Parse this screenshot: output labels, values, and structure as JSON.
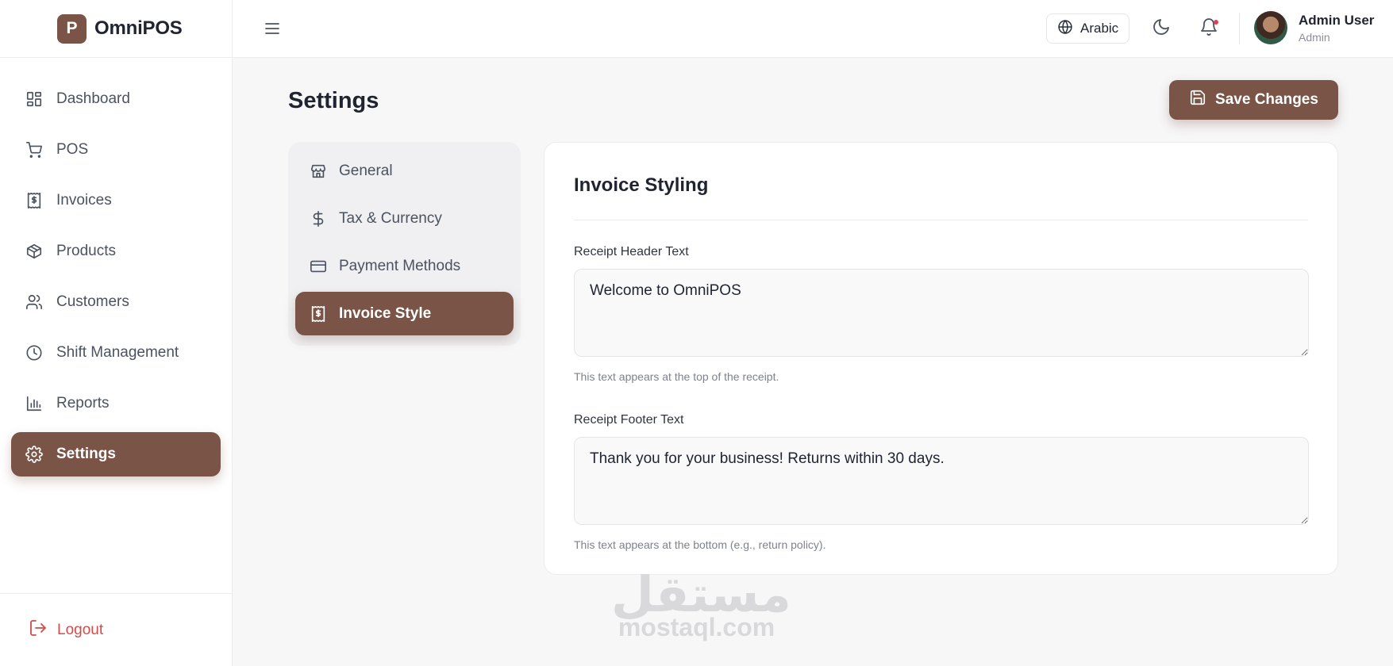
{
  "brand": {
    "logo_letter": "P",
    "name": "OmniPOS"
  },
  "sidebar": {
    "items": [
      {
        "label": "Dashboard",
        "icon": "dashboard-icon",
        "active": false
      },
      {
        "label": "POS",
        "icon": "cart-icon",
        "active": false
      },
      {
        "label": "Invoices",
        "icon": "receipt-icon",
        "active": false
      },
      {
        "label": "Products",
        "icon": "box-icon",
        "active": false
      },
      {
        "label": "Customers",
        "icon": "users-icon",
        "active": false
      },
      {
        "label": "Shift Management",
        "icon": "clock-icon",
        "active": false
      },
      {
        "label": "Reports",
        "icon": "bar-chart-icon",
        "active": false
      },
      {
        "label": "Settings",
        "icon": "gear-icon",
        "active": true
      }
    ],
    "logout_label": "Logout"
  },
  "topbar": {
    "language_label": "Arabic",
    "user": {
      "name": "Admin User",
      "role": "Admin"
    }
  },
  "page": {
    "title": "Settings",
    "save_label": "Save Changes"
  },
  "settings_nav": {
    "items": [
      {
        "label": "General",
        "icon": "store-icon",
        "active": false
      },
      {
        "label": "Tax & Currency",
        "icon": "dollar-icon",
        "active": false
      },
      {
        "label": "Payment Methods",
        "icon": "credit-card-icon",
        "active": false
      },
      {
        "label": "Invoice Style",
        "icon": "receipt-icon",
        "active": true
      }
    ]
  },
  "invoice_styling": {
    "title": "Invoice Styling",
    "header_label": "Receipt Header Text",
    "header_value": "Welcome to OmniPOS",
    "header_hint": "This text appears at the top of the receipt.",
    "footer_label": "Receipt Footer Text",
    "footer_value": "Thank you for your business! Returns within 30 days.",
    "footer_hint": "This text appears at the bottom (e.g., return policy)."
  },
  "watermark": {
    "arabic": "مستقل",
    "latin": "mostaql.com"
  },
  "colors": {
    "accent": "#7a5446",
    "danger": "#d54a4a",
    "notification": "#e0414d"
  }
}
